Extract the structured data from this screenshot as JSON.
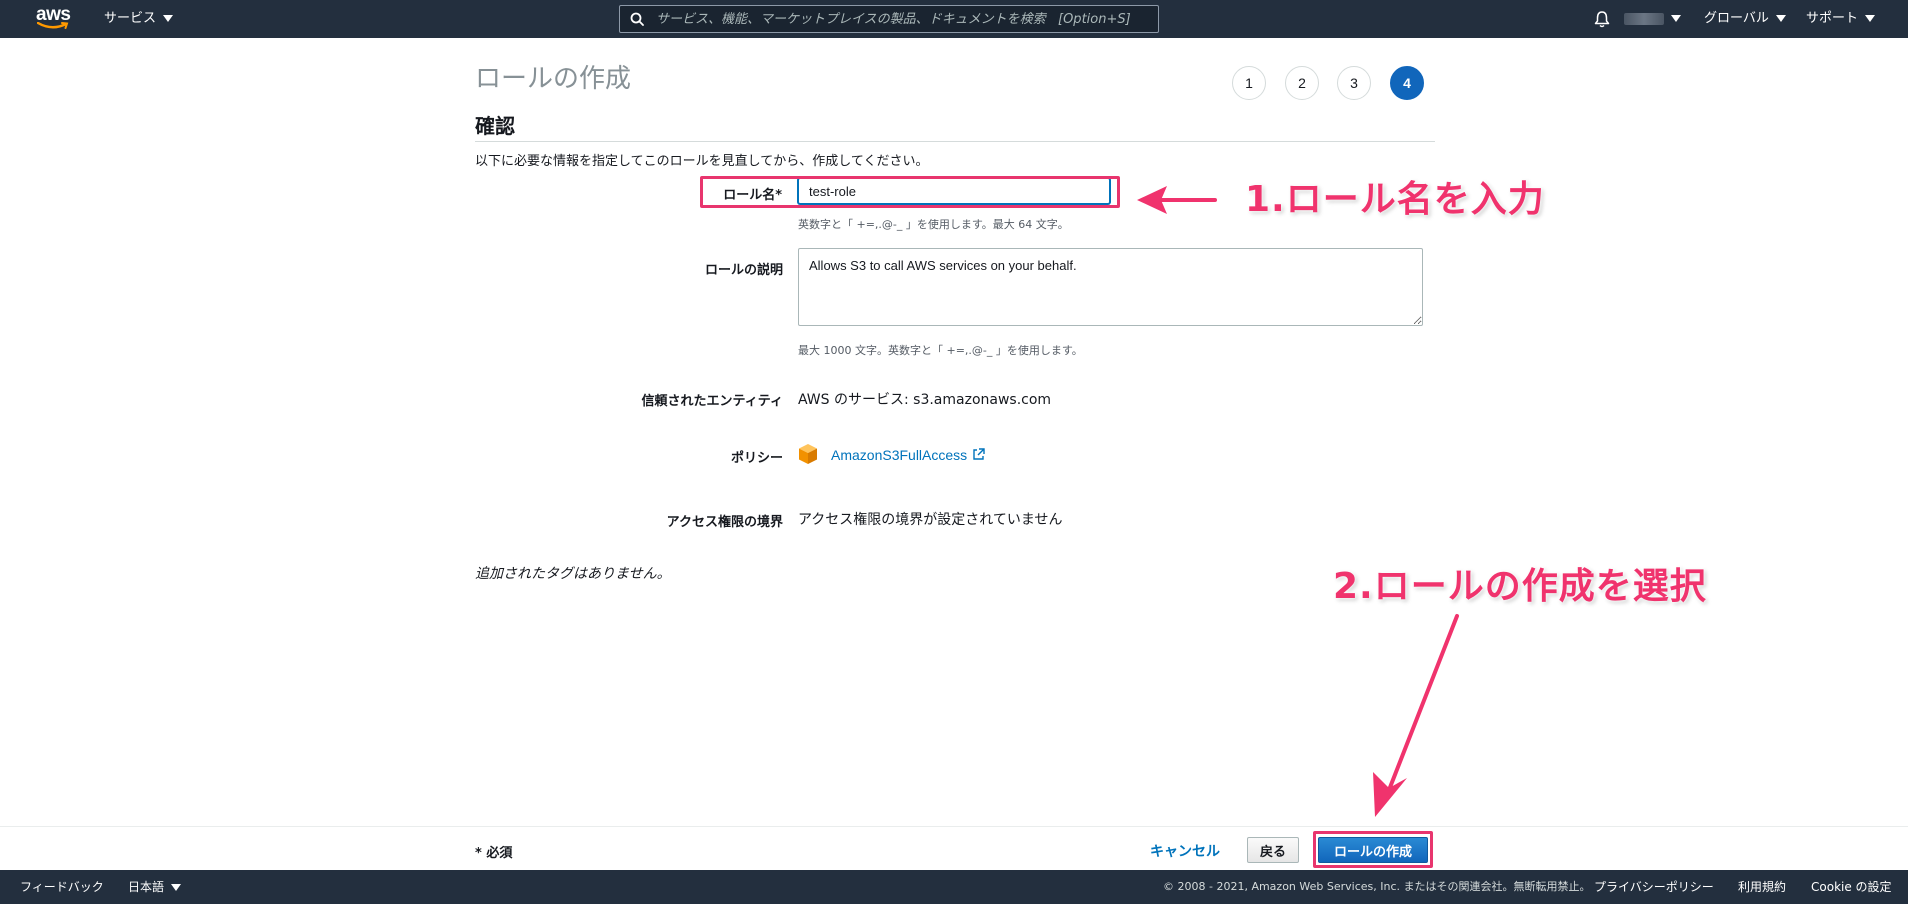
{
  "topnav": {
    "logo_text": "aws",
    "services_label": "サービス",
    "search_placeholder": "サービス、機能、マーケットプレイスの製品、ドキュメントを検索   [Option+S]",
    "region_label": "グローバル",
    "support_label": "サポート"
  },
  "page": {
    "title": "ロールの作成",
    "steps": [
      "1",
      "2",
      "3",
      "4"
    ],
    "active_step": "4",
    "section_title": "確認",
    "intro": "以下に必要な情報を指定してこのロールを見直してから、作成してください。"
  },
  "form": {
    "role_name_label": "ロール名*",
    "role_name_value": "test-role",
    "role_name_hint": "英数字と「 +=,.@-_ 」を使用します。最大 64 文字。",
    "description_label": "ロールの説明",
    "description_value": "Allows S3 to call AWS services on your behalf.",
    "description_hint": "最大 1000 文字。英数字と「 +=,.@-_ 」を使用します。",
    "trusted_entity_label": "信頼されたエンティティ",
    "trusted_entity_value": "AWS のサービス: s3.amazonaws.com",
    "policy_label": "ポリシー",
    "policy_value": "AmazonS3FullAccess",
    "boundary_label": "アクセス権限の境界",
    "boundary_value": "アクセス権限の境界が設定されていません",
    "no_tags": "追加されたタグはありません。"
  },
  "annotations": {
    "step1": "1.ロール名を入力",
    "step2": "2.ロールの作成を選択",
    "accent_color": "#f0336d"
  },
  "actions": {
    "required": "* 必須",
    "cancel": "キャンセル",
    "back": "戻る",
    "create": "ロールの作成"
  },
  "footer": {
    "feedback": "フィードバック",
    "language": "日本語",
    "copyright": "© 2008 - 2021, Amazon Web Services, Inc. またはその関連会社。無断転用禁止。",
    "privacy": "プライバシーポリシー",
    "terms": "利用規約",
    "cookie": "Cookie の設定"
  }
}
